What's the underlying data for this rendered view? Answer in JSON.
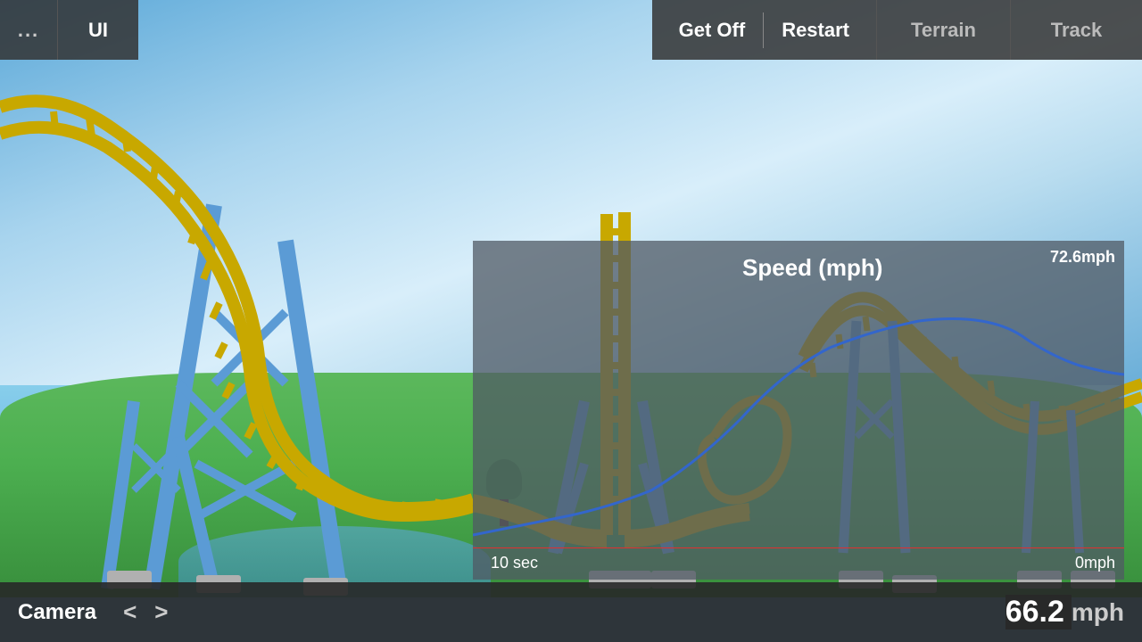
{
  "toolbar": {
    "dots_label": "...",
    "ui_label": "UI",
    "get_off_label": "Get Off",
    "restart_label": "Restart",
    "terrain_label": "Terrain",
    "track_label": "Track"
  },
  "chart": {
    "title": "Speed (mph)",
    "max_speed": "72.6mph",
    "min_speed": "0mph",
    "time_label": "10 sec"
  },
  "bottom_bar": {
    "camera_label": "Camera",
    "prev_label": "<",
    "next_label": ">",
    "speed_value": "66.2",
    "speed_unit": "mph"
  }
}
